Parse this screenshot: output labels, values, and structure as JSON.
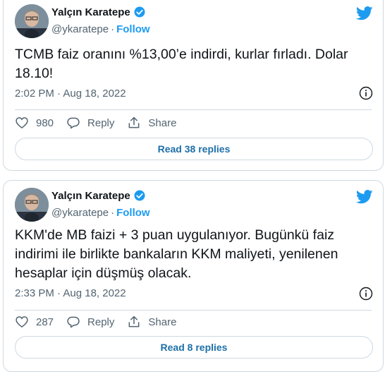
{
  "tweets": [
    {
      "author": "Yalçın Karatepe",
      "handle": "@ykaratepe",
      "follow_label": "Follow",
      "text": "TCMB faiz oranını %13,00’e indirdi, kurlar fırladı. Dolar 18.10!",
      "timestamp": "2:02 PM · Aug 18, 2022",
      "likes": "980",
      "reply_label": "Reply",
      "share_label": "Share",
      "read_replies_label": "Read 38 replies"
    },
    {
      "author": "Yalçın Karatepe",
      "handle": "@ykaratepe",
      "follow_label": "Follow",
      "text": "KKM'de MB faizi + 3 puan uygulanıyor. Bugünkü faiz indirimi ile birlikte bankaların KKM maliyeti, yenilenen hesaplar için düşmüş olacak.",
      "timestamp": "2:33 PM · Aug 18, 2022",
      "likes": "287",
      "reply_label": "Reply",
      "share_label": "Share",
      "read_replies_label": "Read 8 replies"
    }
  ],
  "colors": {
    "accent": "#1d9bf0",
    "text": "#0f1419",
    "secondary": "#536471",
    "border": "#cfd9de"
  },
  "icons": [
    "twitter-bird-icon",
    "verified-badge-icon",
    "info-icon",
    "heart-icon",
    "reply-icon",
    "share-icon"
  ]
}
